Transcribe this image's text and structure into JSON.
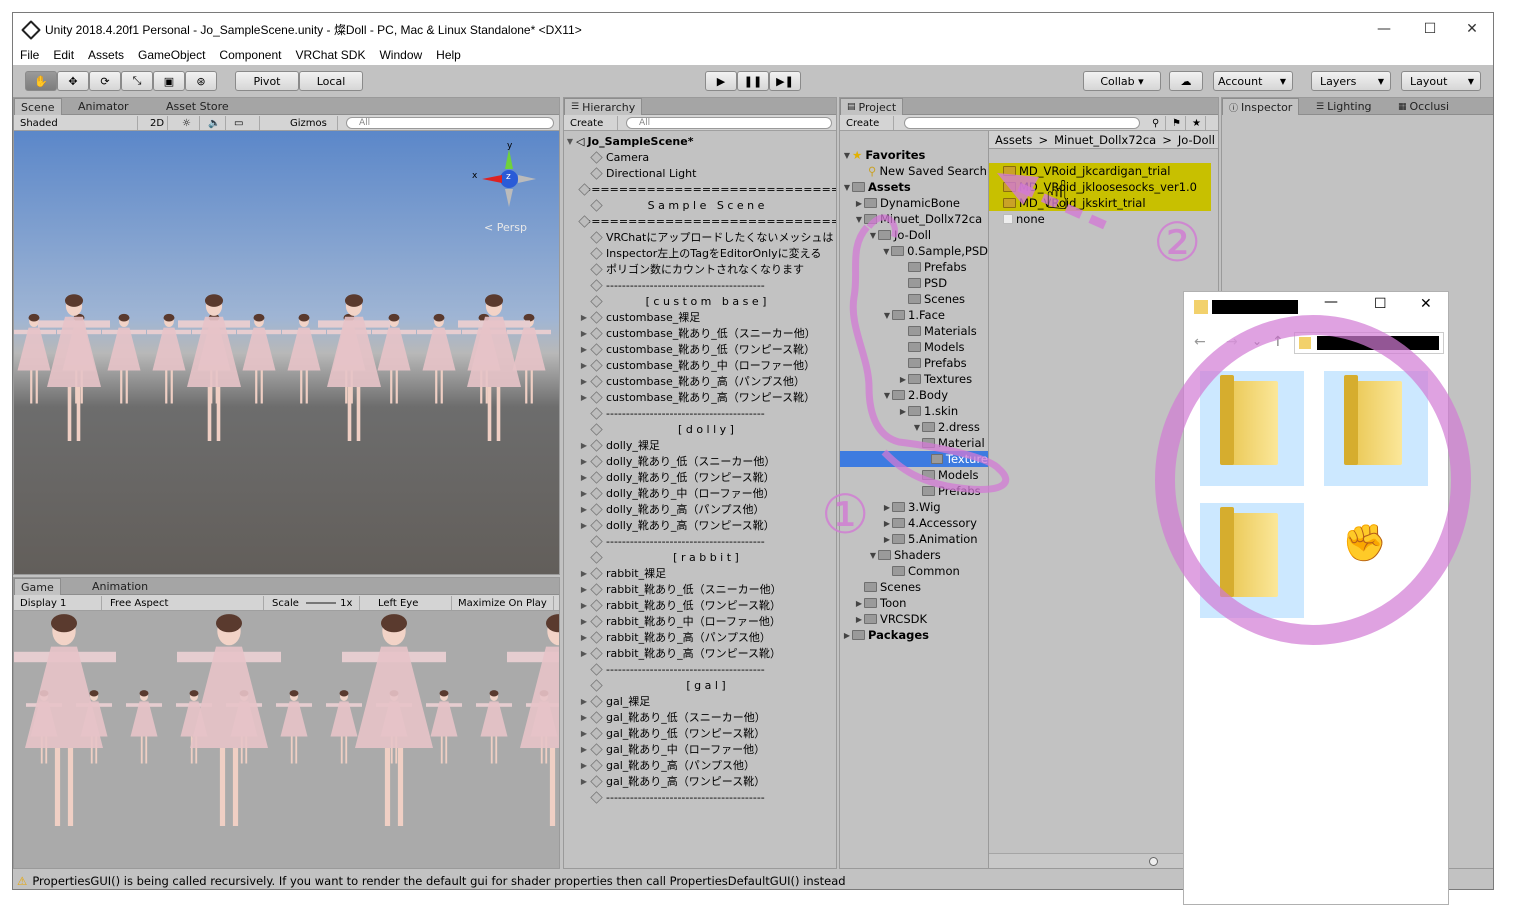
{
  "window": {
    "title": "Unity 2018.4.20f1 Personal - Jo_SampleScene.unity - 燦Doll - PC, Mac & Linux Standalone* <DX11>",
    "minimize": "—",
    "maximize": "☐",
    "close": "✕"
  },
  "menu": [
    "File",
    "Edit",
    "Assets",
    "GameObject",
    "Component",
    "VRChat SDK",
    "Window",
    "Help"
  ],
  "toolbar": {
    "pivot": "Pivot",
    "local": "Local",
    "collab": "Collab ▾",
    "account": "Account",
    "layers": "Layers",
    "layout": "Layout",
    "play": "▶",
    "pause": "❚❚",
    "step": "▶❚"
  },
  "scene_panel": {
    "tabs": [
      "Scene",
      "Animator",
      "Asset Store"
    ],
    "shading": "Shaded",
    "mode2d": "2D",
    "gizmos": "Gizmos",
    "search": "All",
    "persp": "Persp",
    "axis_x": "x",
    "axis_y": "y",
    "axis_z": "z"
  },
  "game_panel": {
    "tabs": [
      "Game",
      "Animation"
    ],
    "display": "Display 1",
    "aspect": "Free Aspect",
    "scale_label": "Scale",
    "scale_value": "1x",
    "eye": "Left Eye",
    "maximize": "Maximize On Play"
  },
  "hierarchy": {
    "tab": "Hierarchy",
    "create": "Create",
    "search": "All",
    "scene": "Jo_SampleScene*",
    "items": [
      {
        "text": "Camera",
        "arrow": ""
      },
      {
        "text": "Directional Light",
        "arrow": ""
      },
      {
        "text": "================================",
        "arrow": ""
      },
      {
        "text": "S a m p l e   S c e n e",
        "arrow": "",
        "center": true
      },
      {
        "text": "================================",
        "arrow": ""
      },
      {
        "text": "VRChatにアップロードしたくないメッシュは",
        "arrow": ""
      },
      {
        "text": "Inspector左上のTagをEditorOnlyに変える",
        "arrow": ""
      },
      {
        "text": "ポリゴン数にカウントされなくなります",
        "arrow": ""
      },
      {
        "text": "----------------------------------------",
        "arrow": ""
      },
      {
        "text": "[ c u s t o m   b a s e ]",
        "arrow": "",
        "center": true
      },
      {
        "text": "custombase_裸足",
        "arrow": "▶"
      },
      {
        "text": "custombase_靴あり_低（スニーカー他）",
        "arrow": "▶"
      },
      {
        "text": "custombase_靴あり_低（ワンピース靴）",
        "arrow": "▶"
      },
      {
        "text": "custombase_靴あり_中（ローファー他）",
        "arrow": "▶"
      },
      {
        "text": "custombase_靴あり_高（パンプス他）",
        "arrow": "▶"
      },
      {
        "text": "custombase_靴あり_高（ワンピース靴）",
        "arrow": "▶"
      },
      {
        "text": "----------------------------------------",
        "arrow": ""
      },
      {
        "text": "[ d o l l y ]",
        "arrow": "",
        "center": true
      },
      {
        "text": "dolly_裸足",
        "arrow": "▶"
      },
      {
        "text": "dolly_靴あり_低（スニーカー他）",
        "arrow": "▶"
      },
      {
        "text": "dolly_靴あり_低（ワンピース靴）",
        "arrow": "▶"
      },
      {
        "text": "dolly_靴あり_中（ローファー他）",
        "arrow": "▶"
      },
      {
        "text": "dolly_靴あり_高（パンプス他）",
        "arrow": "▶"
      },
      {
        "text": "dolly_靴あり_高（ワンピース靴）",
        "arrow": "▶"
      },
      {
        "text": "----------------------------------------",
        "arrow": ""
      },
      {
        "text": "[ r a b b i t ]",
        "arrow": "",
        "center": true
      },
      {
        "text": "rabbit_裸足",
        "arrow": "▶"
      },
      {
        "text": "rabbit_靴あり_低（スニーカー他）",
        "arrow": "▶"
      },
      {
        "text": "rabbit_靴あり_低（ワンピース靴）",
        "arrow": "▶"
      },
      {
        "text": "rabbit_靴あり_中（ローファー他）",
        "arrow": "▶"
      },
      {
        "text": "rabbit_靴あり_高（パンプス他）",
        "arrow": "▶"
      },
      {
        "text": "rabbit_靴あり_高（ワンピース靴）",
        "arrow": "▶"
      },
      {
        "text": "----------------------------------------",
        "arrow": ""
      },
      {
        "text": "[ g a l ]",
        "arrow": "",
        "center": true
      },
      {
        "text": "gal_裸足",
        "arrow": "▶"
      },
      {
        "text": "gal_靴あり_低（スニーカー他）",
        "arrow": "▶"
      },
      {
        "text": "gal_靴あり_低（ワンピース靴）",
        "arrow": "▶"
      },
      {
        "text": "gal_靴あり_中（ローファー他）",
        "arrow": "▶"
      },
      {
        "text": "gal_靴あり_高（パンプス他）",
        "arrow": "▶"
      },
      {
        "text": "gal_靴あり_高（ワンピース靴）",
        "arrow": "▶"
      },
      {
        "text": "----------------------------------------",
        "arrow": ""
      }
    ]
  },
  "project": {
    "tab": "Project",
    "create": "Create",
    "breadcrumb": [
      "Assets",
      "Minuet_Dollx72ca",
      "Jo-Doll"
    ],
    "tree": [
      {
        "text": "Favorites",
        "bold": true,
        "arrow": "▼",
        "star": true
      },
      {
        "text": "New Saved Search",
        "arrow": "",
        "search": true
      },
      {
        "text": "Assets",
        "bold": true,
        "arrow": "▼"
      },
      {
        "text": "DynamicBone",
        "arrow": "▶"
      },
      {
        "text": "Minuet_Dollx72ca",
        "arrow": "▼"
      },
      {
        "text": "Jo-Doll",
        "arrow": "▼"
      },
      {
        "text": "0.Sample,PSD",
        "arrow": "▼"
      },
      {
        "text": "Prefabs",
        "arrow": ""
      },
      {
        "text": "PSD",
        "arrow": ""
      },
      {
        "text": "Scenes",
        "arrow": ""
      },
      {
        "text": "1.Face",
        "arrow": "▼"
      },
      {
        "text": "Materials",
        "arrow": ""
      },
      {
        "text": "Models",
        "arrow": ""
      },
      {
        "text": "Prefabs",
        "arrow": ""
      },
      {
        "text": "Textures",
        "arrow": "▶"
      },
      {
        "text": "2.Body",
        "arrow": "▼"
      },
      {
        "text": "1.skin",
        "arrow": "▶"
      },
      {
        "text": "2.dress",
        "arrow": "▼"
      },
      {
        "text": "Material",
        "arrow": ""
      },
      {
        "text": "Texture",
        "arrow": "",
        "selected": true
      },
      {
        "text": "Models",
        "arrow": ""
      },
      {
        "text": "Prefabs",
        "arrow": ""
      },
      {
        "text": "3.Wig",
        "arrow": "▶"
      },
      {
        "text": "4.Accessory",
        "arrow": "▶"
      },
      {
        "text": "5.Animation",
        "arrow": "▶"
      },
      {
        "text": "Shaders",
        "arrow": "▼"
      },
      {
        "text": "Common",
        "arrow": ""
      },
      {
        "text": "Scenes",
        "arrow": ""
      },
      {
        "text": "Toon",
        "arrow": "▶"
      },
      {
        "text": "VRCSDK",
        "arrow": "▶"
      },
      {
        "text": "Packages",
        "bold": true,
        "arrow": "▶"
      }
    ],
    "files": [
      "MD_VRoid_jkcardigan_trial",
      "MD_VRoid_jkloosesocks_ver1.0",
      "MD_VRoid_jkskirt_trial",
      "none"
    ]
  },
  "inspector": {
    "tabs": [
      "Inspector",
      "Lighting",
      "Occlusi"
    ]
  },
  "annotations": {
    "num1": "①",
    "num2": "②"
  },
  "status": {
    "message": "PropertiesGUI() is being called recursively. If you want to render the default gui for shader properties then call PropertiesDefaultGUI() instead"
  },
  "explorer": {
    "minimize": "—",
    "maximize": "☐",
    "close": "✕",
    "back": "←",
    "forward": "→",
    "dropdown": "⌄",
    "up": "↑"
  },
  "colors": {
    "selection": "#3d7be0",
    "highlight_files": "#c8c000",
    "annotation": "#d27ad4"
  }
}
